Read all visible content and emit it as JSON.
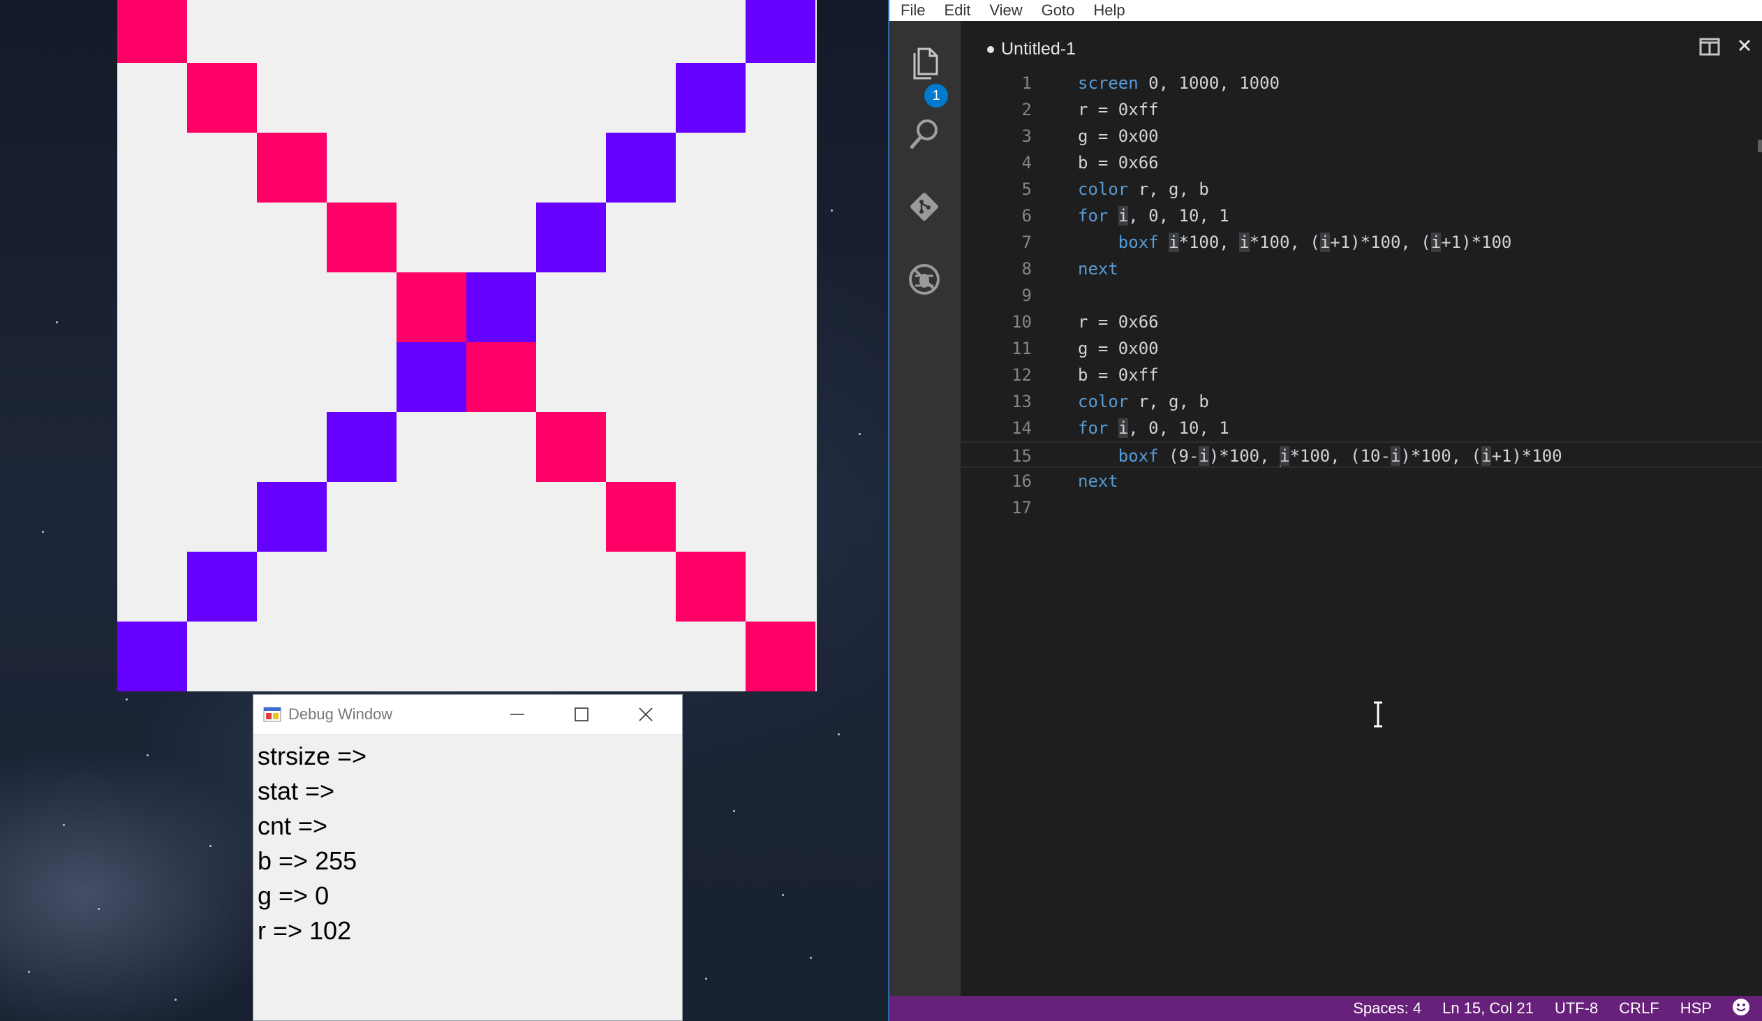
{
  "screen_window": {
    "grid_cells": 10,
    "pink_color": "#ff0066",
    "purple_color": "#6600ff",
    "background_color": "#f0f0f0"
  },
  "debug_window": {
    "title": "Debug Window",
    "lines": [
      "strsize =>",
      "stat =>",
      "cnt =>",
      "b => 255",
      "g => 0",
      "r => 102"
    ]
  },
  "editor": {
    "menu": [
      "File",
      "Edit",
      "View",
      "Goto",
      "Help"
    ],
    "tab_title": "Untitled-1",
    "explorer_badge": "1",
    "line_numbers": [
      "1",
      "2",
      "3",
      "4",
      "5",
      "6",
      "7",
      "8",
      "9",
      "10",
      "11",
      "12",
      "13",
      "14",
      "15",
      "16",
      "17"
    ],
    "current_line": 15,
    "status": {
      "spaces": "Spaces: 4",
      "position": "Ln 15, Col 21",
      "encoding": "UTF-8",
      "eol": "CRLF",
      "language": "HSP"
    },
    "accent_color": "#68217a"
  }
}
